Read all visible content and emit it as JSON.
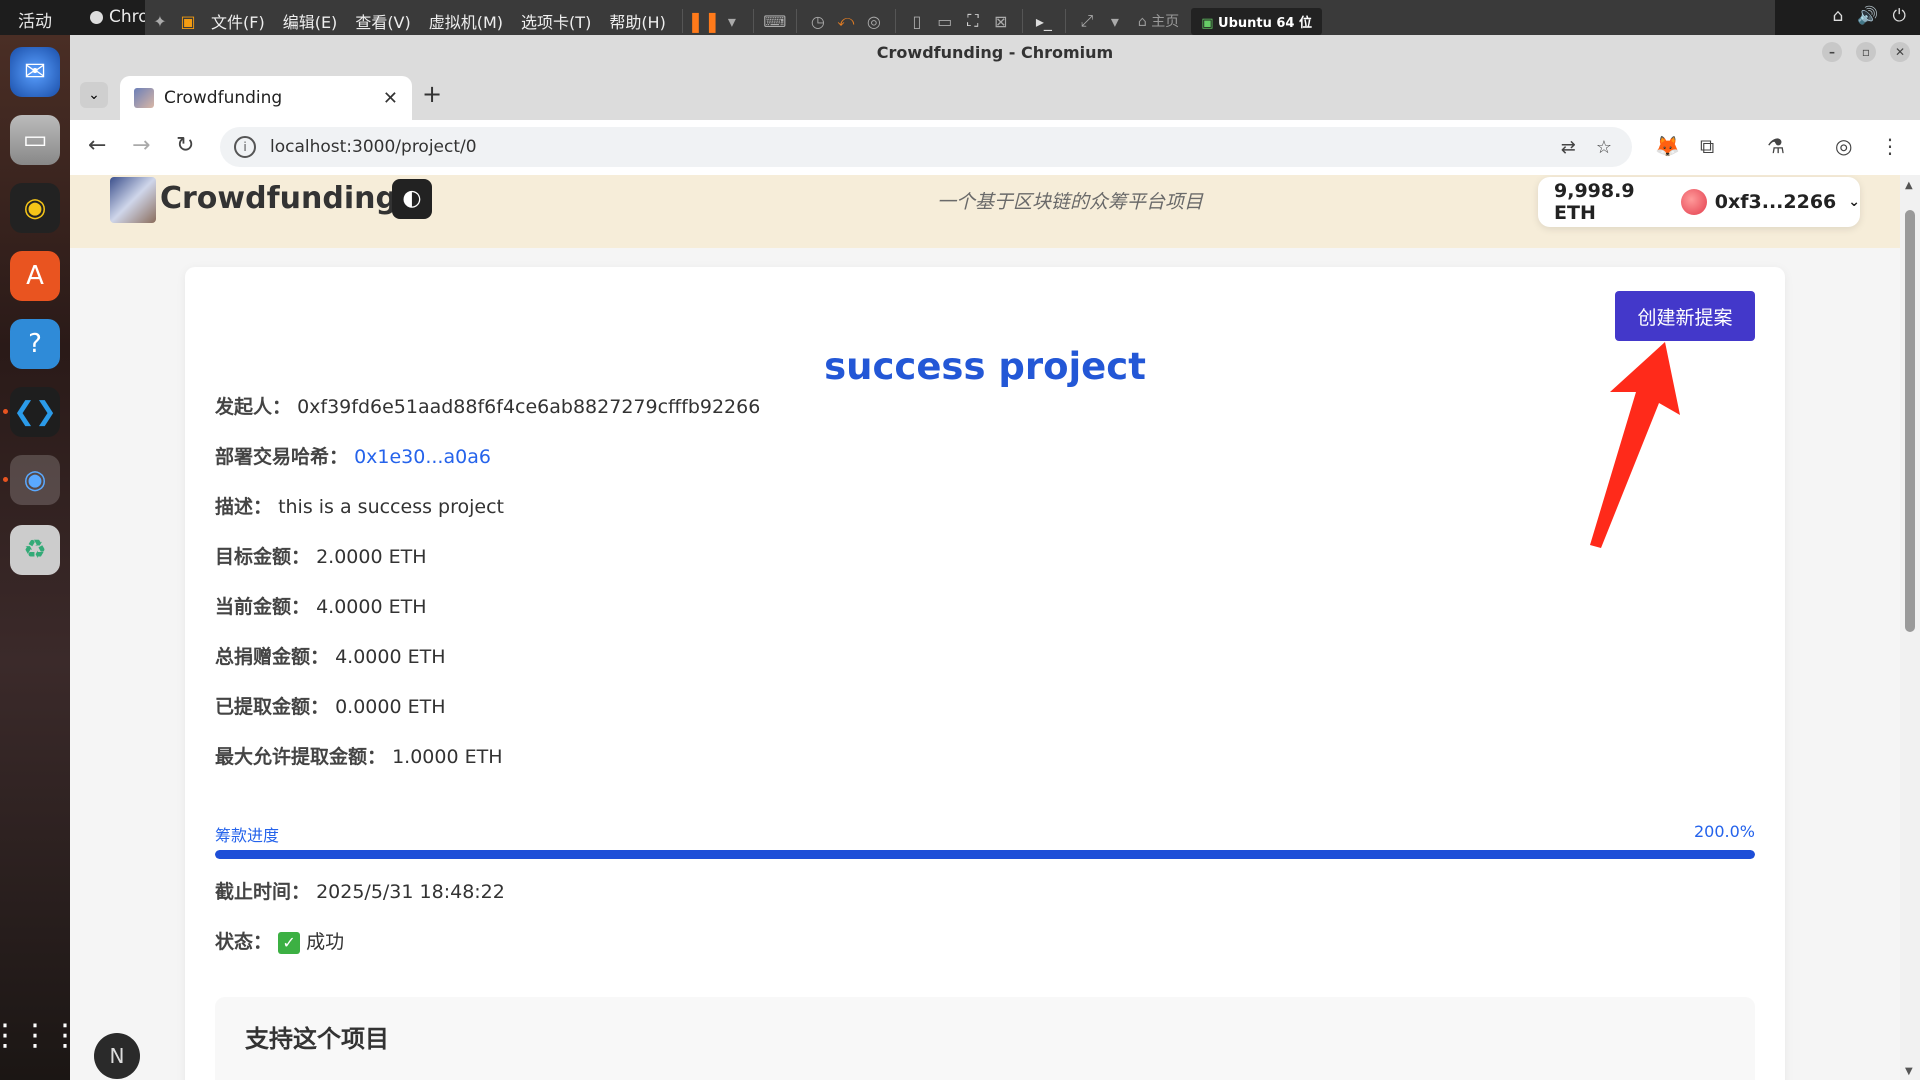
{
  "topbar": {
    "activities": "活动",
    "chrome_label": "Chro",
    "vm_menu": [
      "文件(F)",
      "编辑(E)",
      "查看(V)",
      "虚拟机(M)",
      "选项卡(T)",
      "帮助(H)"
    ],
    "vm_home": "主页",
    "vm_tab": "Ubuntu 64 位"
  },
  "window": {
    "title": "Crowdfunding - Chromium",
    "tab_title": "Crowdfunding",
    "url": "localhost:3000/project/0"
  },
  "site": {
    "brand": "Crowdfunding",
    "tagline": "一个基于区块链的众筹平台项目",
    "balance": "9,998.9 ETH",
    "account": "0xf3...2266"
  },
  "project": {
    "create_button": "创建新提案",
    "title": "success project",
    "fields": {
      "initiator": {
        "label": "发起人：",
        "value": "0xf39fd6e51aad88f6f4ce6ab8827279cfffb92266"
      },
      "tx_hash": {
        "label": "部署交易哈希：",
        "value": "0x1e30...a0a6"
      },
      "description": {
        "label": "描述：",
        "value": "this is a success project"
      },
      "goal": {
        "label": "目标金额：",
        "value": "2.0000 ETH"
      },
      "current": {
        "label": "当前金额：",
        "value": "4.0000 ETH"
      },
      "total_donated": {
        "label": "总捐赠金额：",
        "value": "4.0000 ETH"
      },
      "withdrawn": {
        "label": "已提取金额：",
        "value": "0.0000 ETH"
      },
      "max_withdraw": {
        "label": "最大允许提取金额：",
        "value": "1.0000 ETH"
      },
      "deadline": {
        "label": "截止时间：",
        "value": "2025/5/31 18:48:22"
      },
      "status": {
        "label": "状态：",
        "value": "成功"
      }
    },
    "progress": {
      "label": "筹款进度",
      "percent_text": "200.0%",
      "fill_fraction": 1.0
    },
    "support_heading": "支持这个项目"
  },
  "colors": {
    "accent": "#4338ca",
    "title_blue": "#2357d6",
    "link_blue": "#2563eb",
    "header_bg": "#f6edd9",
    "annotation_red": "#ff2a1a"
  }
}
